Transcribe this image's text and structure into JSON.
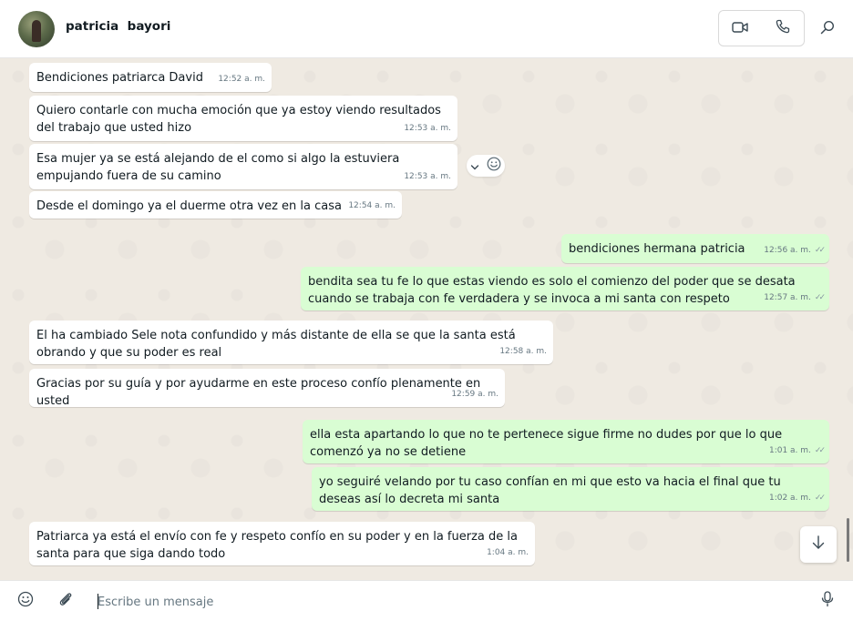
{
  "header": {
    "contact_name": "patricia  bayori",
    "video_icon": "video-camera-icon",
    "call_icon": "phone-icon",
    "search_icon": "search-icon"
  },
  "messages": [
    {
      "dir": "in",
      "text": "Bendiciones patriarca David",
      "time": "12:52 a. m."
    },
    {
      "dir": "in",
      "text": "Quiero contarle con mucha emoción que ya estoy viendo resultados del trabajo que usted hizo",
      "time": "12:53 a. m."
    },
    {
      "dir": "in",
      "text": "Esa mujer ya se está alejando de el como si algo la estuviera empujando fuera de su camino",
      "time": "12:53 a. m."
    },
    {
      "dir": "in",
      "text": "Desde el domingo ya el duerme otra vez en la casa",
      "time": "12:54 a. m."
    },
    {
      "dir": "out",
      "text": "bendiciones hermana patricia",
      "time": "12:56 a. m."
    },
    {
      "dir": "out",
      "text": "bendita sea tu fe lo que estas viendo es solo el comienzo del poder que se desata cuando se trabaja con fe verdadera y se invoca a mi santa con respeto",
      "time": "12:57 a. m."
    },
    {
      "dir": "in",
      "text": "El ha cambiado Sele nota confundido y más distante de ella se que la santa está obrando y que su poder es real",
      "time": "12:58 a. m."
    },
    {
      "dir": "in",
      "text": "Gracias por su guía y por ayudarme en este proceso confío plenamente en usted",
      "time": "12:59 a. m."
    },
    {
      "dir": "out",
      "text": "ella esta apartando lo que no te pertenece sigue firme no dudes por que lo que comenzó ya no se detiene",
      "time": "1:01 a. m."
    },
    {
      "dir": "out",
      "text": "yo seguiré velando por tu caso confían en mi que esto va hacia el final que tu deseas así lo decreta mi santa",
      "time": "1:02 a. m."
    },
    {
      "dir": "in",
      "text": "Patriarca ya está el envío con fe y respeto confío en su poder y en la fuerza de la santa para que siga dando todo",
      "time": "1:04 a. m."
    }
  ],
  "read_ticks": "✓✓",
  "composer": {
    "placeholder": "Escribe un mensaje",
    "emoji_icon": "emoji-icon",
    "attach_icon": "paperclip-icon",
    "mic_icon": "microphone-icon"
  },
  "colors": {
    "incoming_bubble": "#ffffff",
    "outgoing_bubble": "#d9fdd3",
    "chat_background": "#efeae2",
    "timestamp": "#667781"
  }
}
